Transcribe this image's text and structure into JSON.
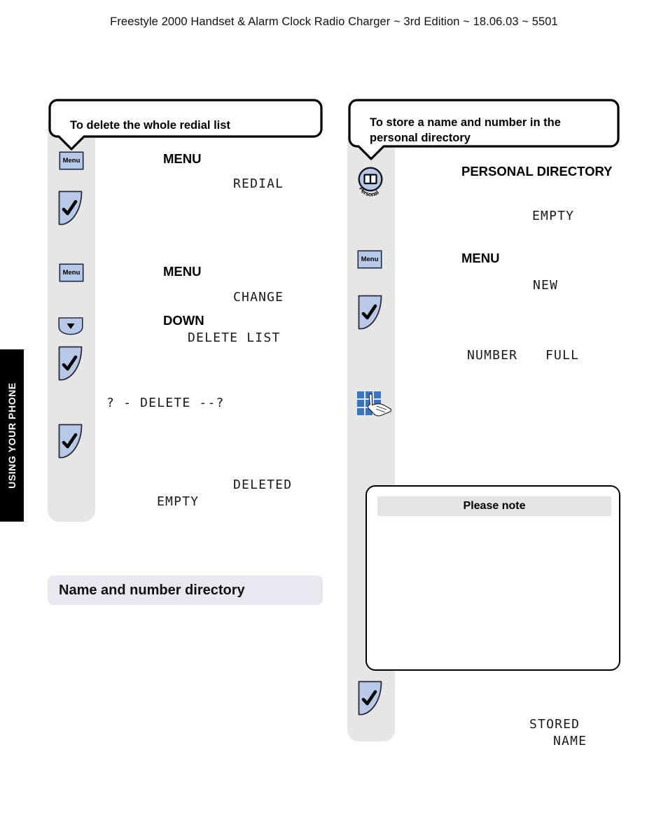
{
  "header": {
    "running_title": "Freestyle 2000 Handset & Alarm Clock Radio Charger  ~ 3rd Edition ~ 18.06.03 ~ 5501"
  },
  "side_tab": {
    "label": "USING YOUR PHONE"
  },
  "left_column": {
    "callout": "To delete the whole redial list",
    "keys": [
      {
        "icon": "menu-key-icon",
        "label": "Menu"
      },
      {
        "icon": "tick-key-icon",
        "label": ""
      },
      {
        "icon": "menu-key-icon",
        "label": "Menu"
      },
      {
        "icon": "down-key-icon",
        "label": ""
      },
      {
        "icon": "tick-key-icon",
        "label": ""
      },
      {
        "icon": "tick-key-icon",
        "label": ""
      }
    ],
    "keynames": {
      "menu_1": "MENU",
      "menu_2": "MENU",
      "down": "DOWN"
    },
    "display": {
      "redial": "REDIAL",
      "change": "CHANGE",
      "delete_list": "DELETE LIST",
      "confirm": "? - DELETE --?",
      "deleted": "DELETED",
      "empty": "EMPTY"
    }
  },
  "right_column": {
    "callout": "To store a name and number in the personal directory",
    "keys": [
      {
        "icon": "personal-directory-key-icon",
        "label": "Personal"
      },
      {
        "icon": "menu-key-icon",
        "label": "Menu"
      },
      {
        "icon": "tick-key-icon",
        "label": ""
      },
      {
        "icon": "keypad-key-icon",
        "label": ""
      },
      {
        "icon": "tick-key-icon",
        "label": ""
      }
    ],
    "keynames": {
      "personal_directory": "PERSONAL DIRECTORY",
      "menu": "MENU"
    },
    "display": {
      "empty": "EMPTY",
      "new": "NEW",
      "number": "NUMBER",
      "full": "FULL",
      "stored": "STORED",
      "name": "NAME"
    }
  },
  "section_heading": {
    "label": "Name and number directory"
  },
  "note_box": {
    "title": "Please note",
    "body": ""
  },
  "colors": {
    "key_fill": "#b8c9e8",
    "strip_grey": "#e6e6e6",
    "section_bar": "#e7e8f0",
    "note_header_grey": "#e4e4e4",
    "keypad_blue": "#3a74bd",
    "side_tab_black": "#000000"
  }
}
